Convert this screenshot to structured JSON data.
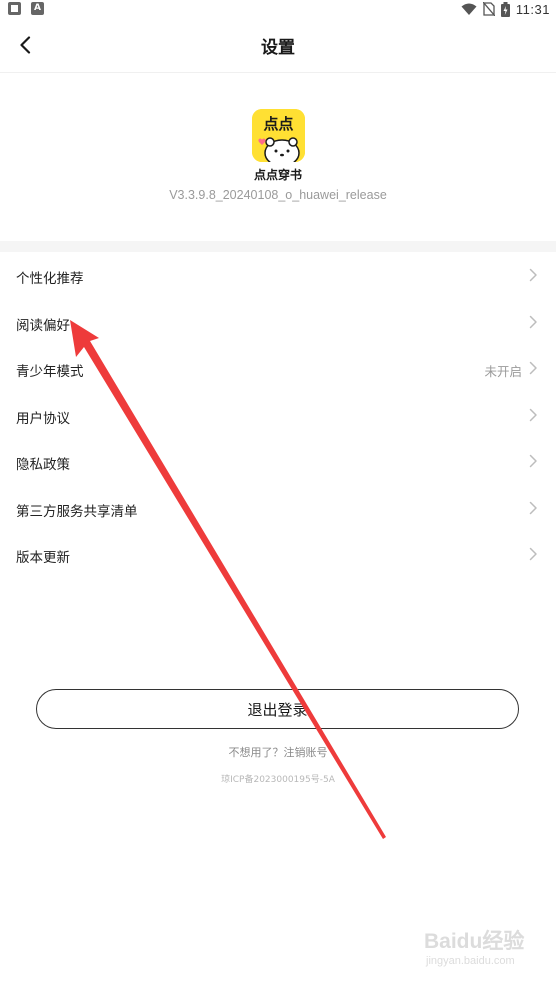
{
  "status_bar": {
    "time": "11:31",
    "left_icons": [
      "notification-icon",
      "a-notification-icon"
    ],
    "right_icons": [
      "wifi-icon",
      "no-sim-icon",
      "battery-charging-icon"
    ]
  },
  "header": {
    "title": "设置",
    "back_icon": "back-arrow-icon"
  },
  "app": {
    "name": "点点穿书",
    "logo_text": "点点",
    "version": "V3.3.9.8_20240108_o_huawei_release"
  },
  "settings": [
    {
      "label": "个性化推荐",
      "value": ""
    },
    {
      "label": "阅读偏好",
      "value": ""
    },
    {
      "label": "青少年模式",
      "value": "未开启"
    },
    {
      "label": "用户协议",
      "value": ""
    },
    {
      "label": "隐私政策",
      "value": ""
    },
    {
      "label": "第三方服务共享清单",
      "value": ""
    },
    {
      "label": "版本更新",
      "value": ""
    }
  ],
  "account": {
    "logout_label": "退出登录",
    "cancel_prompt": "不想用了？注销账号",
    "icp": "琼ICP备2023000195号-5A"
  },
  "annotation": {
    "arrow_color": "#ee3b3b"
  },
  "watermark": {
    "main": "Baidu经验",
    "sub": "jingyan.baidu.com"
  },
  "colors": {
    "logo_bg": "#ffe033",
    "text_primary": "#222222",
    "text_secondary": "#9a9a9a",
    "divider_bg": "#f5f5f5"
  }
}
